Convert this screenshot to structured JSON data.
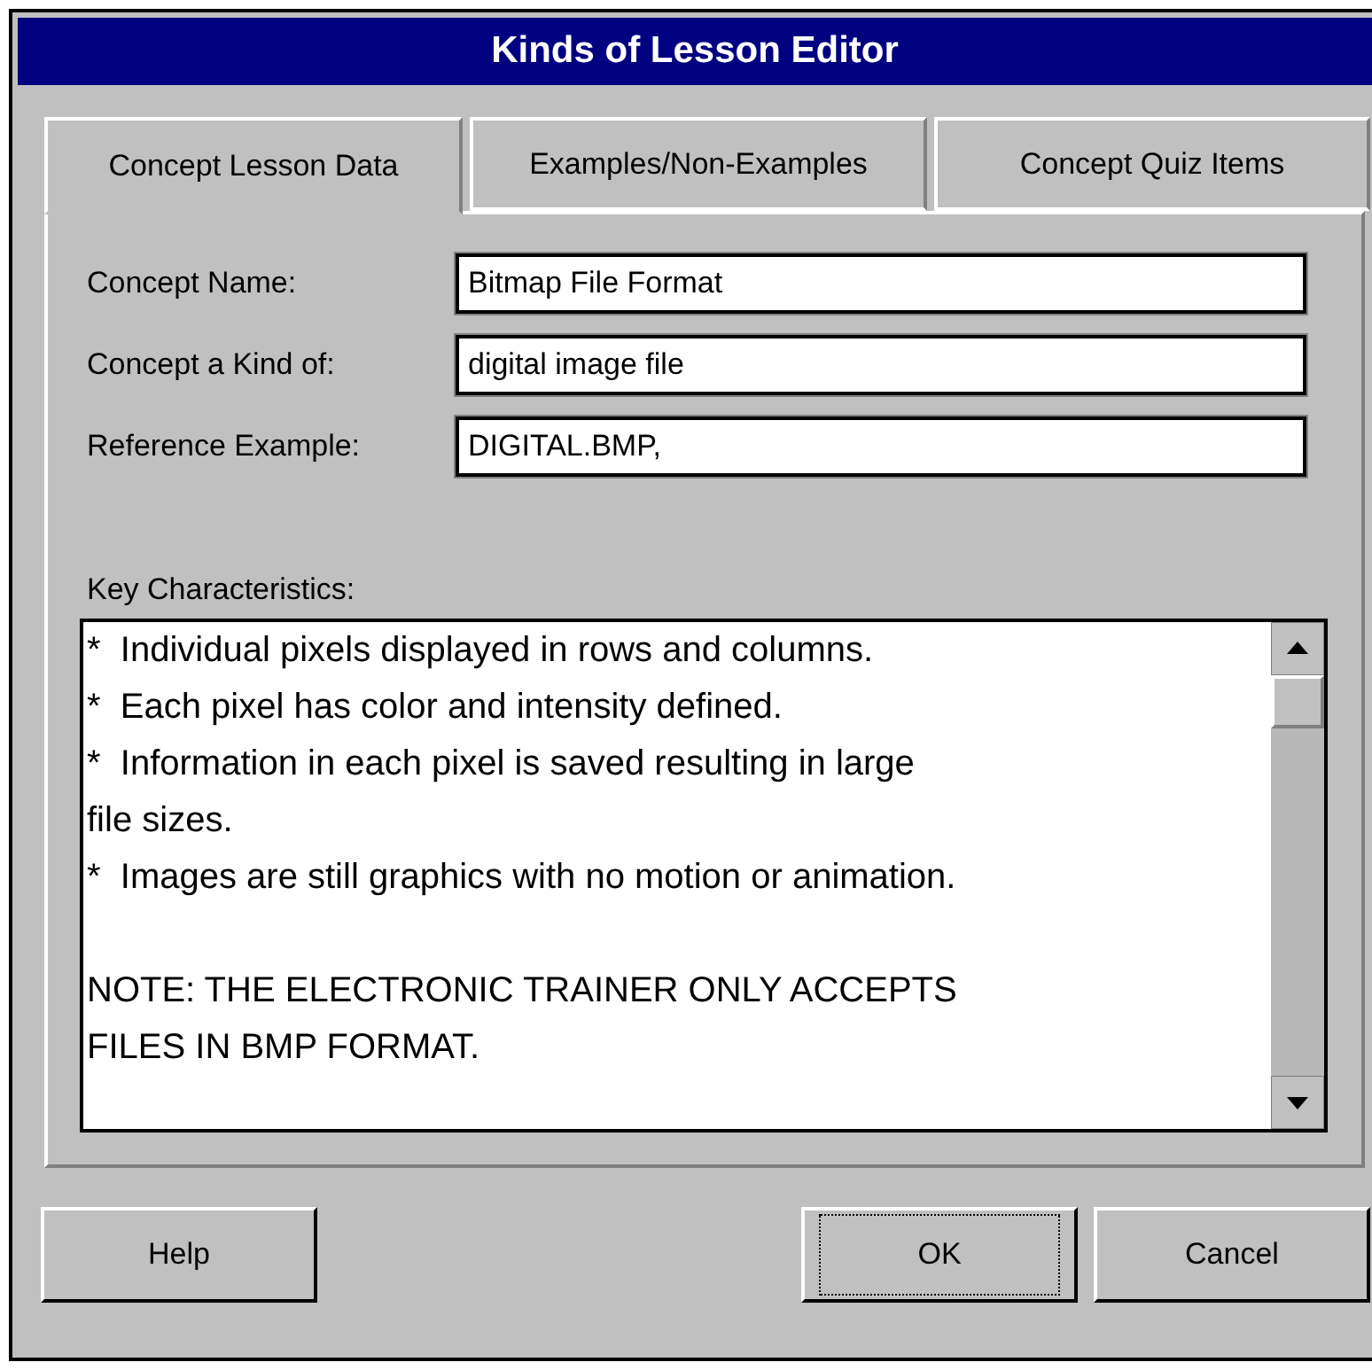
{
  "window": {
    "title": "Kinds of Lesson Editor"
  },
  "tabs": [
    {
      "label": "Concept Lesson Data",
      "selected": true
    },
    {
      "label": "Examples/Non-Examples",
      "selected": false
    },
    {
      "label": "Concept Quiz Items",
      "selected": false
    }
  ],
  "fields": [
    {
      "label": "Concept Name:",
      "value": "Bitmap File Format"
    },
    {
      "label": "Concept a Kind of:",
      "value": "digital image file"
    },
    {
      "label": "Reference Example:",
      "value": "DIGITAL.BMP,"
    }
  ],
  "key_characteristics": {
    "label": "Key Characteristics:",
    "text": "*  Individual pixels displayed in rows and columns.\n*  Each pixel has color and intensity defined.\n*  Information in each pixel is saved resulting in large\nfile sizes.\n*  Images are still graphics with no motion or animation.\n\nNOTE: THE ELECTRONIC TRAINER ONLY ACCEPTS\nFILES IN BMP FORMAT."
  },
  "buttons": [
    {
      "label": "Help",
      "focused": false
    },
    {
      "label": "OK",
      "focused": true
    },
    {
      "label": "Cancel",
      "focused": false
    }
  ]
}
